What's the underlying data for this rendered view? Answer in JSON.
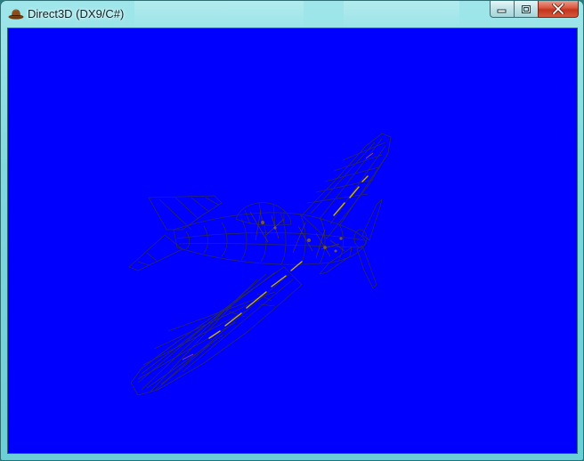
{
  "window": {
    "title": "Direct3D (DX9/C#)",
    "app_icon": "hat-icon",
    "viewport_background": "#0000ff",
    "frame_color": "#7fd9de"
  },
  "caption_buttons": [
    {
      "name": "minimize",
      "icon": "minimize-icon"
    },
    {
      "name": "maximize",
      "icon": "maximize-icon"
    },
    {
      "name": "close",
      "icon": "close-icon"
    }
  ],
  "scene": {
    "content": "wireframe propeller aircraft model",
    "wire_color": "#2a2a55",
    "highlight_color": "#c8b400"
  }
}
